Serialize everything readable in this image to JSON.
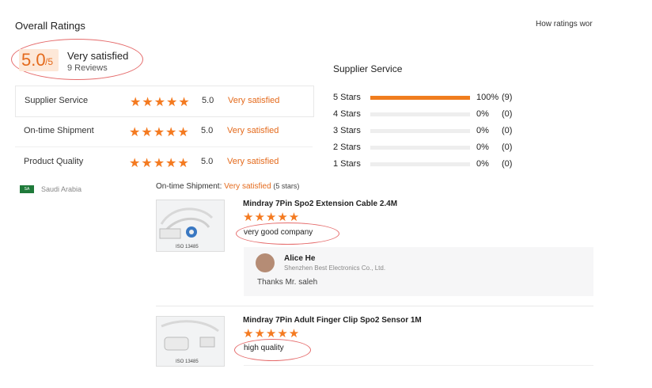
{
  "header": {
    "title": "Overall Ratings",
    "how_link": "How ratings wor"
  },
  "summary": {
    "score": "5.0",
    "score_suffix": "/5",
    "label": "Very satisfied",
    "reviews": "9 Reviews"
  },
  "ratings": [
    {
      "label": "Supplier Service",
      "stars": "★★★★★",
      "value": "5.0",
      "text": "Very satisfied"
    },
    {
      "label": "On-time Shipment",
      "stars": "★★★★★",
      "value": "5.0",
      "text": "Very satisfied"
    },
    {
      "label": "Product Quality",
      "stars": "★★★★★",
      "value": "5.0",
      "text": "Very satisfied"
    }
  ],
  "distribution": {
    "title": "Supplier Service",
    "rows": [
      {
        "label": "5 Stars",
        "fraction": 1.0,
        "pct": "100%",
        "count": "(9)"
      },
      {
        "label": "4 Stars",
        "fraction": 0.0,
        "pct": "0%",
        "count": "(0)"
      },
      {
        "label": "3 Stars",
        "fraction": 0.0,
        "pct": "0%",
        "count": "(0)"
      },
      {
        "label": "2 Stars",
        "fraction": 0.0,
        "pct": "0%",
        "count": "(0)"
      },
      {
        "label": "1 Stars",
        "fraction": 0.0,
        "pct": "0%",
        "count": "(0)"
      }
    ]
  },
  "review": {
    "country": "Saudi Arabia",
    "flag_text": "SA",
    "ontime_label": "On-time Shipment:",
    "ontime_value": "Very satisfied",
    "ontime_stars": "(5 stars)",
    "products": [
      {
        "title": "Mindray 7Pin Spo2 Extension Cable 2.4M",
        "stars": "★★★★★",
        "comment": "very good company",
        "thumb_caption": "ISO 13485"
      },
      {
        "title": "Mindray 7Pin Adult Finger Clip Spo2 Sensor 1M",
        "stars": "★★★★★",
        "comment": "high quality",
        "thumb_caption": "ISO 13485"
      }
    ],
    "reply": {
      "name": "Alice He",
      "company": "Shenzhen Best Electronics Co., Ltd.",
      "text": "Thanks Mr. saleh"
    }
  },
  "colors": {
    "accent": "#e46a1c",
    "bar": "#f07d1e",
    "annotation": "#e56b6b"
  }
}
